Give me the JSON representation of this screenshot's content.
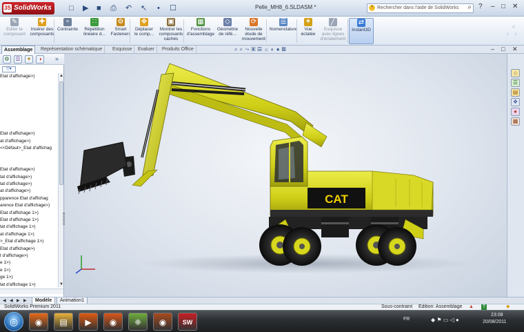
{
  "app": {
    "brand": "SolidWorks",
    "logo_mark": "3S",
    "document_title": "Pelle_MH8_6.SLDASM *"
  },
  "quick_access": [
    "□",
    "▶",
    "■",
    "⎙",
    "↶",
    "↖",
    "•",
    "☐"
  ],
  "search": {
    "placeholder": "Rechercher dans l'aide de SolidWorks",
    "icon": "?"
  },
  "window_controls": {
    "help": "?",
    "minimize": "–",
    "restore": "□",
    "close": "✕"
  },
  "ribbon": [
    {
      "id": "edit-component",
      "label1": "Editer le",
      "label2": "composant",
      "icon": "✎",
      "color": "#9aa5b5",
      "dim": true
    },
    {
      "id": "insert-components",
      "label1": "Insérer des",
      "label2": "composants",
      "icon": "✚",
      "color": "#e0a020"
    },
    {
      "id": "mate",
      "label1": "Contrainte",
      "label2": "",
      "icon": "∘",
      "color": "#6d7f99"
    },
    {
      "id": "linear-pattern",
      "label1": "Répétition",
      "label2": "linéaire d...",
      "icon": "∷",
      "color": "#3d9a3d"
    },
    {
      "id": "smart-fasteners",
      "label1": "Smart",
      "label2": "Fasteners",
      "icon": "⚙",
      "color": "#c58a1b"
    },
    {
      "id": "move-component",
      "label1": "Déplacer",
      "label2": "le comp...",
      "icon": "✥",
      "color": "#e0a020"
    },
    {
      "id": "show-hidden",
      "label1": "Montrer les",
      "label2": "composants",
      "label3": "cachés",
      "icon": "▣",
      "color": "#8a6d3b"
    },
    {
      "id": "assembly-features",
      "label1": "Fonctions",
      "label2": "d'assemblage",
      "icon": "▦",
      "color": "#4a8f3a"
    },
    {
      "id": "reference-geometry",
      "label1": "Géométrie",
      "label2": "de réfé...",
      "icon": "◇",
      "color": "#6a7fa8"
    },
    {
      "id": "new-motion-study",
      "label1": "Nouvelle",
      "label2": "étude de",
      "label3": "mouvement",
      "icon": "⟳",
      "color": "#d9762a"
    },
    {
      "id": "bom",
      "label1": "Nomenclature",
      "label2": "",
      "icon": "☰",
      "color": "#5c88c5"
    },
    {
      "id": "exploded-view",
      "label1": "Vue",
      "label2": "éclatée",
      "icon": "✶",
      "color": "#d4a017"
    },
    {
      "id": "explode-line-sketch",
      "label1": "Esquisse",
      "label2": "avec lignes",
      "label3": "d'éclatement",
      "icon": "╱",
      "color": "#9aa5b5",
      "dim": true
    },
    {
      "id": "instant3d",
      "label1": "Instant3D",
      "label2": "",
      "icon": "⇄",
      "color": "#3a7bd5",
      "active": true
    }
  ],
  "command_tabs": [
    "Assemblage",
    "Représentation schématique",
    "Esquisse",
    "Evaluer",
    "Produits Office"
  ],
  "view_tools": "⌕⌕⤳▣▤☼◐●▩",
  "view_controls": {
    "minimize": "–",
    "restore": "□",
    "close": "✕"
  },
  "panel_tabs": [
    "⚙",
    "☰",
    "✦",
    "◑"
  ],
  "panel_expand": "»",
  "filter_label": "▽▾",
  "tree": [
    "Etat d'affichage>)",
    "",
    "",
    "",
    "",
    "",
    "",
    "",
    "Etat d'affichage>)",
    "at d'affichage>)",
    "<<Défaut>_Etat d'affichag",
    "",
    "",
    "Etat d'affichage>)",
    "tat d'affichage>)",
    "tat d'affichage>)",
    "at d'affichage>)",
    "pparence Etat d'affichag",
    "arence Etat d'affichage>)",
    "Etat d'affichage 1>)",
    "Etat d'affichage 1>)",
    "tat d'affichage 1>)",
    "at d'affichage 1>)",
    ">_Etat d'affichage 1>)",
    "Etat d'affichage>)",
    "t d'affichage>)",
    "e 1>)",
    "e 1>)",
    "ge 1>)",
    "tat d'affichage 1>)"
  ],
  "model": {
    "brand_decal": "CAT"
  },
  "task_pane_icons": [
    "⌂",
    "☰",
    "▤",
    "❖",
    "●",
    "▦"
  ],
  "bottom_tabs": [
    "Modèle",
    "Animation1"
  ],
  "bottom_nav": [
    "◀",
    "◀",
    "▶",
    "▶"
  ],
  "statusbar": {
    "product": "SolidWorks Premium 2011",
    "constraint": "Sous-contraint",
    "mode": "Edition: Assemblage",
    "help": "?"
  },
  "taskbar": {
    "apps": [
      {
        "id": "firefox",
        "icon": "◉",
        "color": "#e66a1a"
      },
      {
        "id": "explorer",
        "icon": "▤",
        "color": "#e7b23b"
      },
      {
        "id": "media-player",
        "icon": "▶",
        "color": "#e05a12"
      },
      {
        "id": "firefox-2",
        "icon": "◉",
        "color": "#d8561a"
      },
      {
        "id": "games",
        "icon": "❈",
        "color": "#6fae3e"
      },
      {
        "id": "firefox-3",
        "icon": "◉",
        "color": "#a84a1c"
      },
      {
        "id": "solidworks",
        "icon": "SW",
        "color": "#c81e24"
      }
    ],
    "lang": "FR",
    "tray": "◆ ⚑ ▭ ◁ ●",
    "time": "23:08",
    "date": "20/08/2011"
  },
  "colors": {
    "machine_yellow": "#d4d41e",
    "cat_black": "#111111",
    "cat_yellow": "#f0d000"
  }
}
